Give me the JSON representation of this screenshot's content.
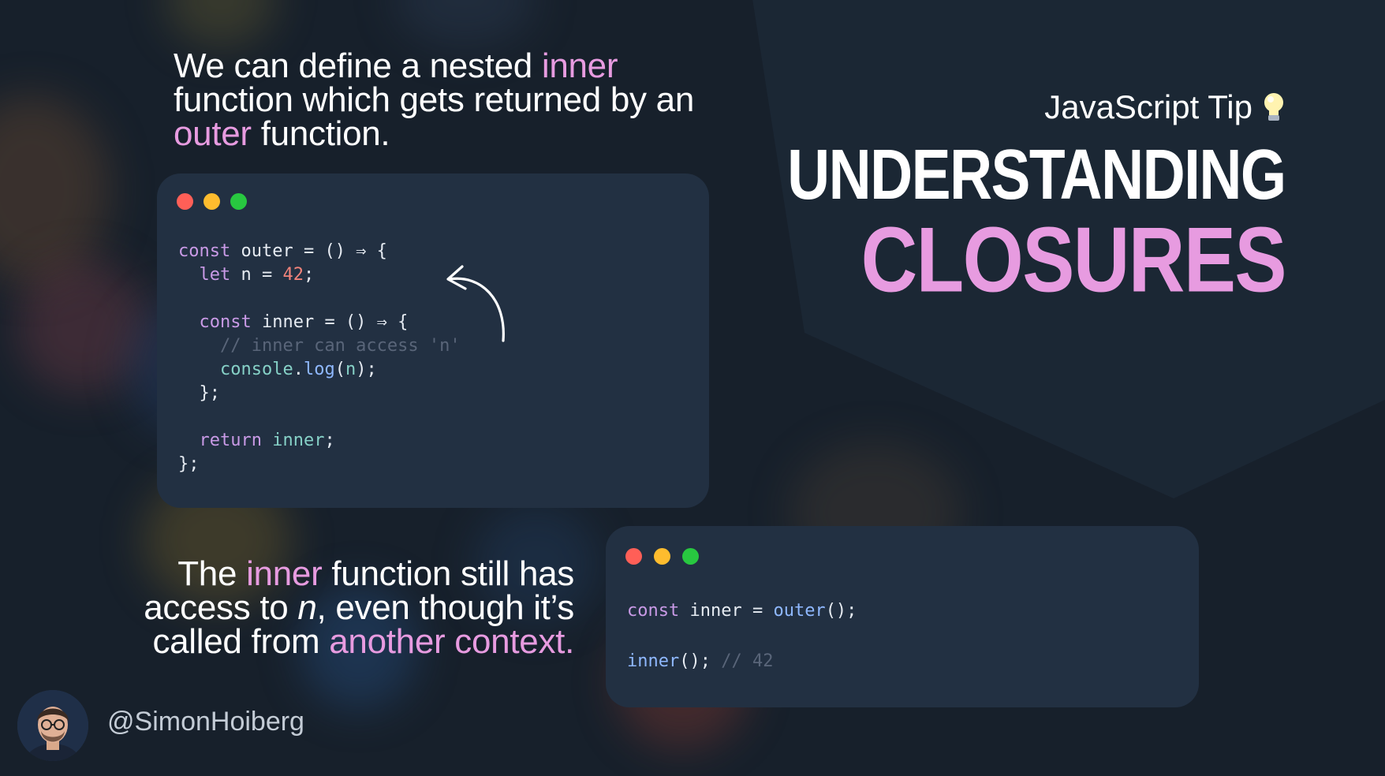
{
  "intro": {
    "p1": "We can define a nested ",
    "h1": "inner",
    "p2": " function which gets returned by an ",
    "h2": "outer",
    "p3": " function."
  },
  "code_window_1": {
    "lines": [
      [
        {
          "t": "const ",
          "c": "kw"
        },
        {
          "t": "outer = () ⇒ {",
          "c": "id"
        }
      ],
      [
        {
          "t": "  let ",
          "c": "kw"
        },
        {
          "t": "n = ",
          "c": "id"
        },
        {
          "t": "42",
          "c": "num"
        },
        {
          "t": ";",
          "c": "id"
        }
      ],
      [],
      [
        {
          "t": "  const ",
          "c": "kw"
        },
        {
          "t": "inner = () ⇒ {",
          "c": "id"
        }
      ],
      [
        {
          "t": "    // inner can access 'n'",
          "c": "cm"
        }
      ],
      [
        {
          "t": "    console",
          "c": "gr"
        },
        {
          "t": ".",
          "c": "id"
        },
        {
          "t": "log",
          "c": "fn"
        },
        {
          "t": "(",
          "c": "id"
        },
        {
          "t": "n",
          "c": "gr"
        },
        {
          "t": ");",
          "c": "id"
        }
      ],
      [
        {
          "t": "  };",
          "c": "id"
        }
      ],
      [],
      [
        {
          "t": "  return ",
          "c": "kw"
        },
        {
          "t": "inner",
          "c": "gr"
        },
        {
          "t": ";",
          "c": "id"
        }
      ],
      [
        {
          "t": "};",
          "c": "id"
        }
      ]
    ]
  },
  "code_window_2": {
    "lines": [
      [
        {
          "t": "const ",
          "c": "kw"
        },
        {
          "t": "inner = ",
          "c": "id"
        },
        {
          "t": "outer",
          "c": "fn"
        },
        {
          "t": "();",
          "c": "id"
        }
      ],
      [],
      [
        {
          "t": "inner",
          "c": "fn"
        },
        {
          "t": "(); ",
          "c": "id"
        },
        {
          "t": "// 42",
          "c": "cm"
        }
      ]
    ]
  },
  "tip": {
    "label": "JavaScript Tip",
    "icon": "lightbulb-icon"
  },
  "title": {
    "line1": "UNDERSTANDING",
    "line2": "CLOSURES"
  },
  "note": {
    "p1": "The ",
    "h1": "inner",
    "p2": " function still has access to ",
    "it": "n",
    "p3": ", even though it’s called from ",
    "h2": "another context."
  },
  "author": {
    "handle": "@SimonHoiberg"
  },
  "colors": {
    "accent": "#e79be0",
    "background": "#17202b",
    "window": "#223042"
  }
}
